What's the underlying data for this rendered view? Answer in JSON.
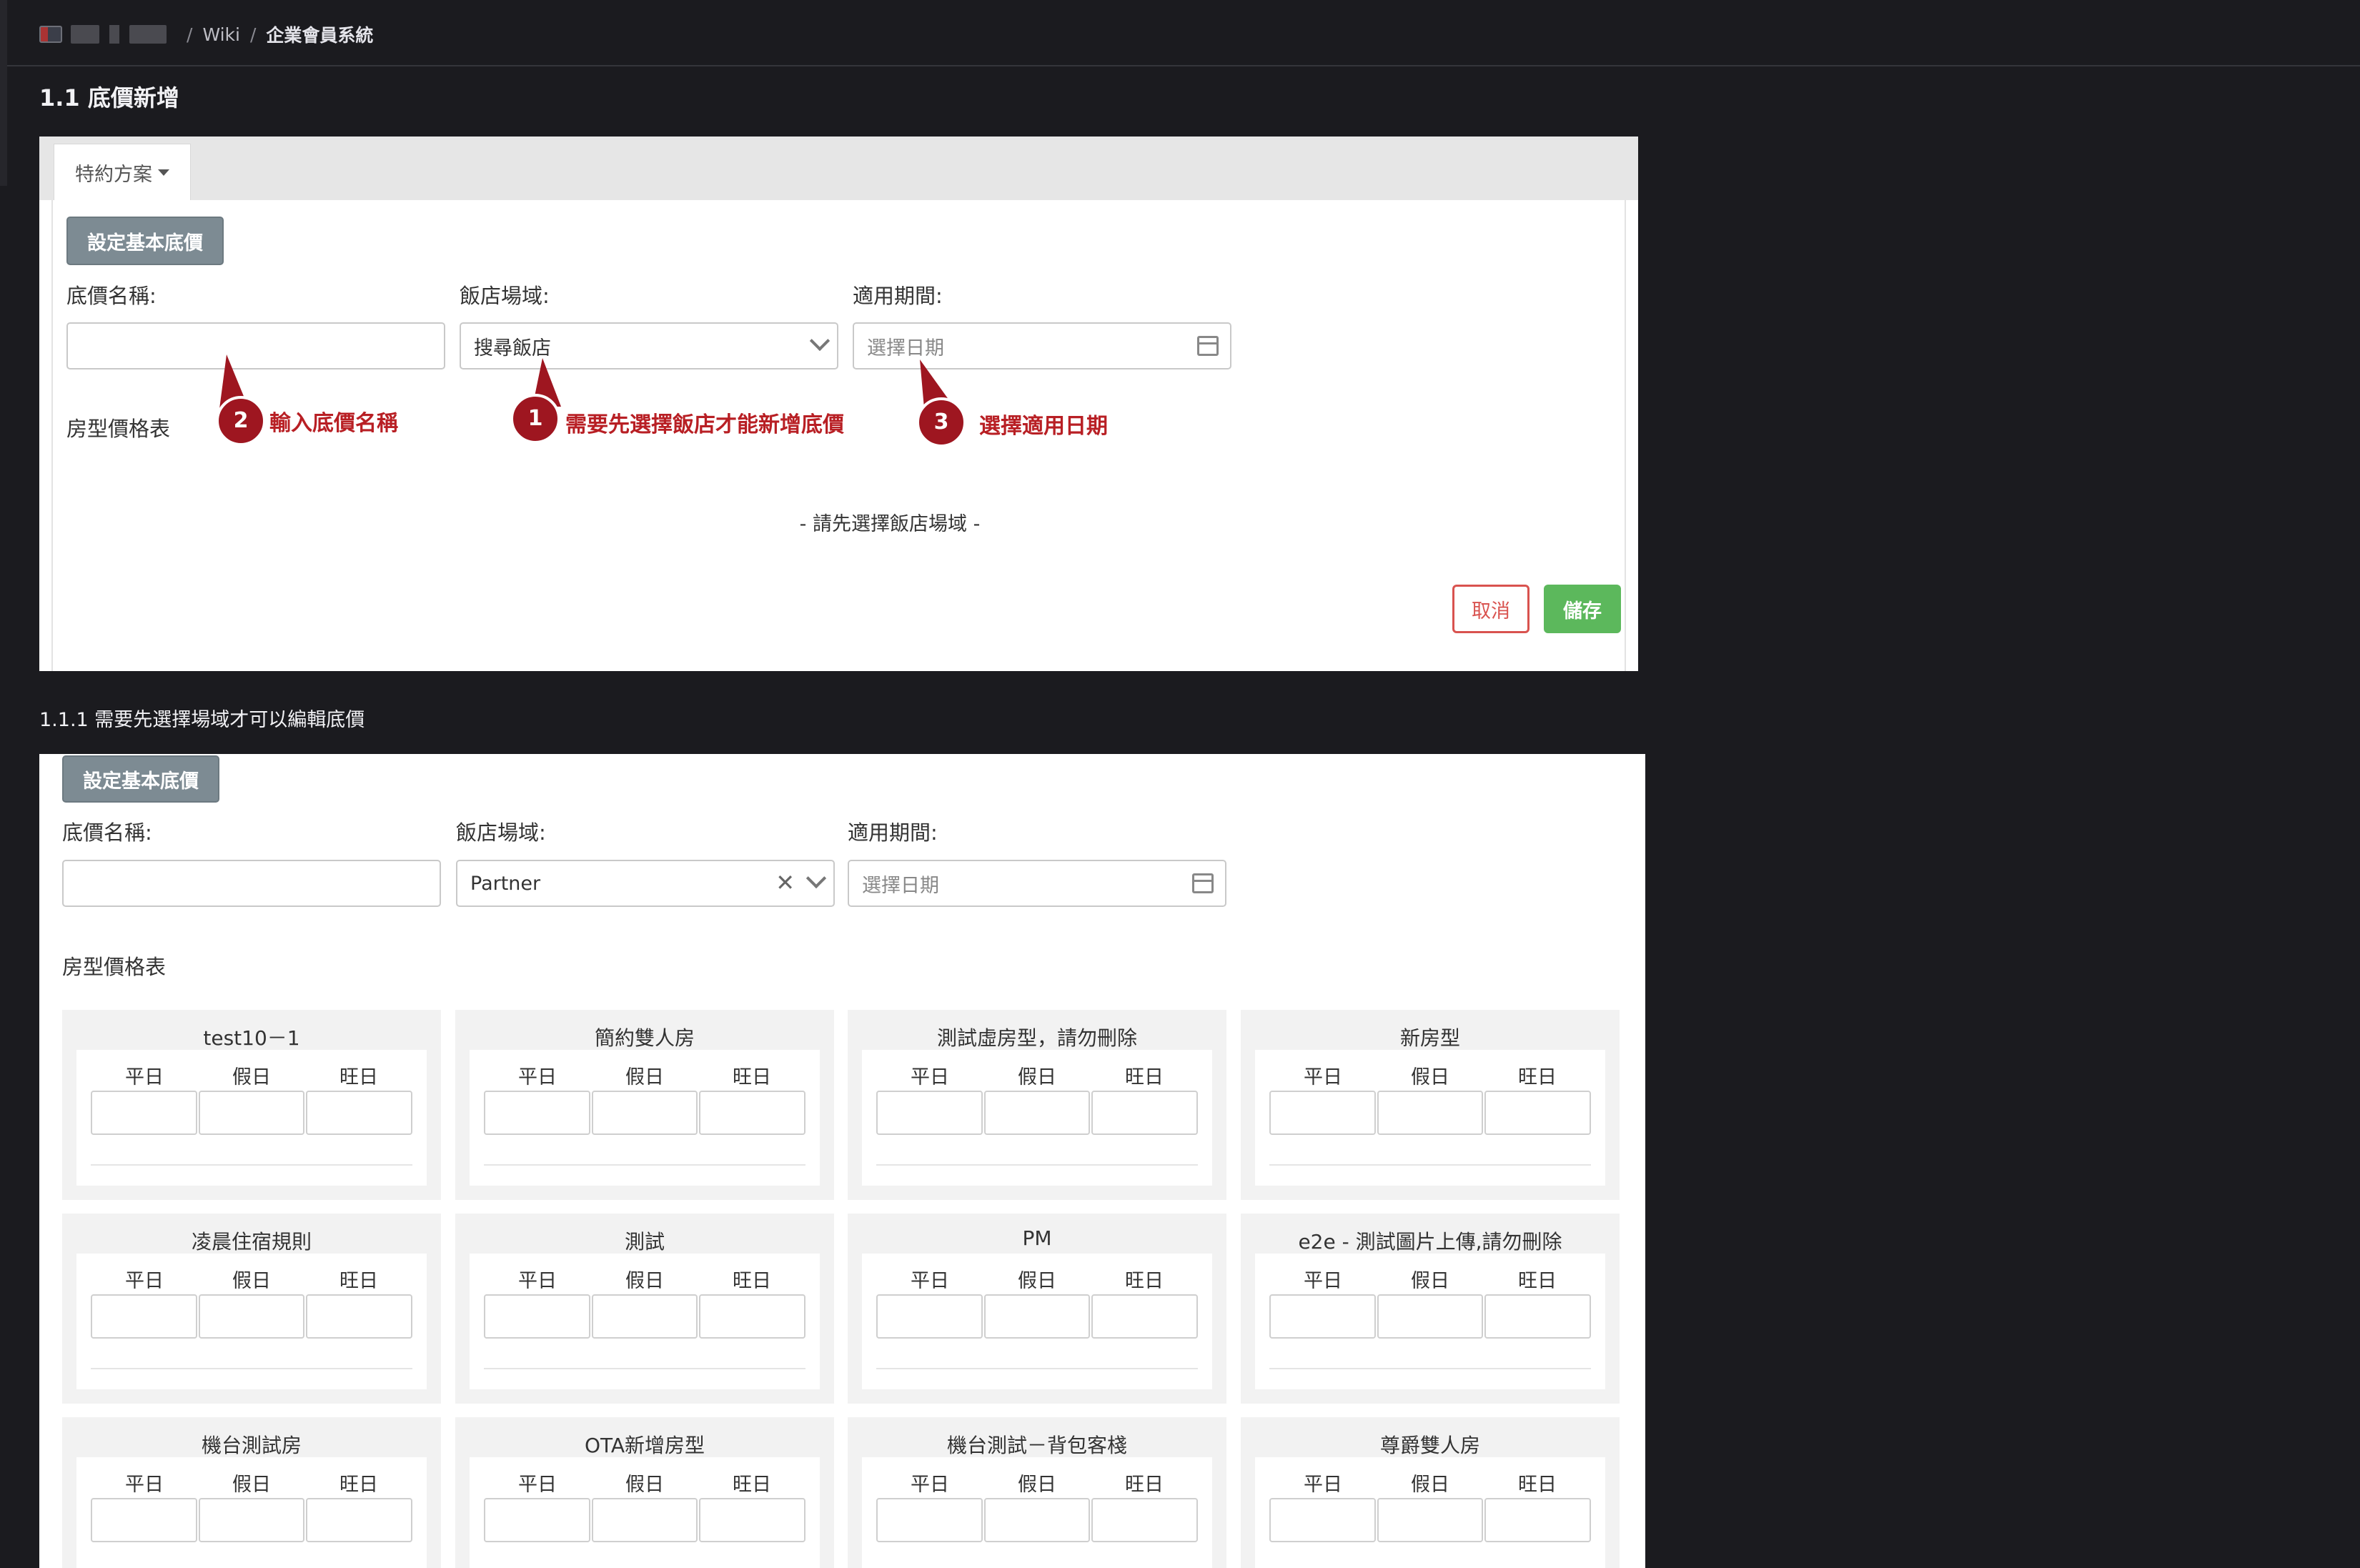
{
  "breadcrumb": {
    "wiki": "Wiki",
    "separator": "/",
    "current": "企業會員系統"
  },
  "section1": {
    "heading": "1.1 底價新增"
  },
  "section1_1": {
    "heading": "1.1.1 需要先選擇場域才可以編輯底價"
  },
  "form1": {
    "tab_label": "特約方案",
    "set_base_price_button": "設定基本底價",
    "name_label": "底價名稱:",
    "name_value": "",
    "hotel_label": "飯店場域:",
    "hotel_value": "搜尋飯店",
    "period_label": "適用期間:",
    "period_placeholder": "選擇日期",
    "room_table_label": "房型價格表",
    "empty_hint": "- 請先選擇飯店場域 -",
    "cancel_button": "取消",
    "save_button": "儲存"
  },
  "annotations": [
    {
      "number": "2",
      "text": "輸入底價名稱"
    },
    {
      "number": "1",
      "text": "需要先選擇飯店才能新增底價"
    },
    {
      "number": "3",
      "text": "選擇適用日期"
    }
  ],
  "annotation_color": "#b81f24",
  "form2": {
    "set_base_price_button": "設定基本底價",
    "name_label": "底價名稱:",
    "name_value": "",
    "hotel_label": "飯店場域:",
    "hotel_value": "Partner",
    "period_label": "適用期間:",
    "period_placeholder": "選擇日期",
    "room_table_label": "房型價格表",
    "price_columns": [
      "平日",
      "假日",
      "旺日"
    ],
    "rooms": [
      "test10－1",
      "簡約雙人房",
      "測試虛房型，請勿刪除",
      "新房型",
      "凌晨住宿規則",
      "測試",
      "PM",
      "e2e - 測試圖片上傳,請勿刪除",
      "機台測試房",
      "OTA新增房型",
      "機台測試－背包客棧",
      "尊爵雙人房"
    ]
  },
  "colors": {
    "save": "#5cb85c",
    "cancel": "#d9534f",
    "gray_button": "#7d8b93",
    "page_bg": "#1b1b1f"
  }
}
